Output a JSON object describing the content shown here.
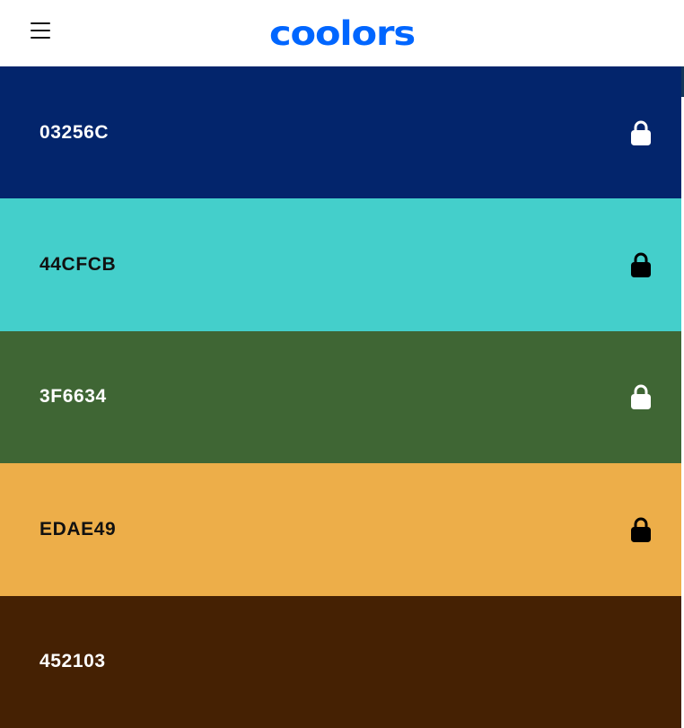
{
  "app": {
    "logo_text": "coolors",
    "brand_color": "#0066ff"
  },
  "topbar": {
    "menu_icon": "hamburger-menu-icon"
  },
  "palette": {
    "swatches": [
      {
        "hex": "03256C",
        "color": "#03256C",
        "text_color": "#ffffff",
        "lock_icon": "lock-icon",
        "lock_color": "#ffffff",
        "locked": true
      },
      {
        "hex": "44CFCB",
        "color": "#44CFCB",
        "text_color": "#111111",
        "lock_icon": "lock-icon",
        "lock_color": "#000000",
        "locked": true
      },
      {
        "hex": "3F6634",
        "color": "#3F6634",
        "text_color": "#ffffff",
        "lock_icon": "lock-icon",
        "lock_color": "#ffffff",
        "locked": true
      },
      {
        "hex": "EDAE49",
        "color": "#EDAE49",
        "text_color": "#111111",
        "lock_icon": "lock-icon",
        "lock_color": "#000000",
        "locked": true
      },
      {
        "hex": "452103",
        "color": "#452103",
        "text_color": "#ffffff",
        "lock_icon": null,
        "lock_color": null,
        "locked": false
      }
    ]
  }
}
